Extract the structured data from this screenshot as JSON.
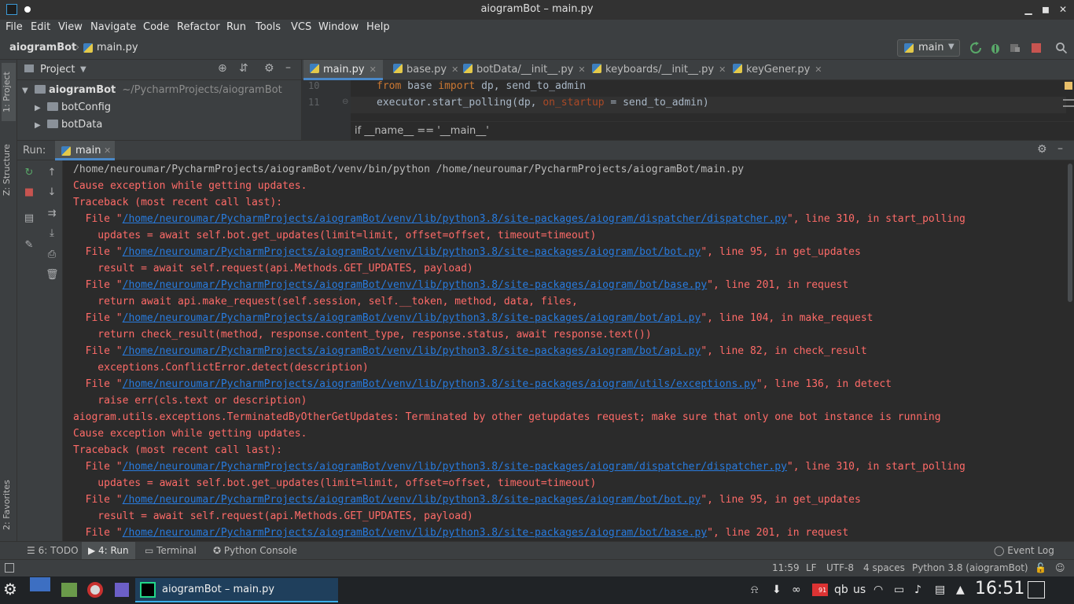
{
  "window": {
    "title": "aiogramBot – main.py"
  },
  "menu": [
    "File",
    "Edit",
    "View",
    "Navigate",
    "Code",
    "Refactor",
    "Run",
    "Tools",
    "VCS",
    "Window",
    "Help"
  ],
  "navbar": {
    "project": "aiogramBot",
    "file": "main.py",
    "run_config": "main"
  },
  "left_strip": {
    "project_tab": "1: Project",
    "structure_tab": "Z: Structure",
    "favorites_tab": "2: Favorites"
  },
  "project_panel": {
    "title": "Project",
    "root": {
      "name": "aiogramBot",
      "path": "~/PycharmProjects/aiogramBot"
    },
    "items": [
      "botConfig",
      "botData"
    ]
  },
  "editor": {
    "tabs": [
      "main.py",
      "base.py",
      "botData/__init__.py",
      "keyboards/__init__.py",
      "keyGener.py"
    ],
    "active_tab": "main.py",
    "lines": [
      {
        "num": "10",
        "kw1": "from",
        "t1": " base ",
        "kw2": "import",
        "t2": " dp, send_to_admin"
      },
      {
        "num": "11",
        "t1": "executor.start_polling(dp, ",
        "param": "on_startup",
        "t2": " = send_to_admin)"
      }
    ],
    "breadcrumb": "if __name__ == '__main__'"
  },
  "run_panel": {
    "label": "Run:",
    "tab": "main",
    "lines": [
      {
        "type": "norm",
        "text": "/home/neuroumar/PycharmProjects/aiogramBot/venv/bin/python /home/neuroumar/PycharmProjects/aiogramBot/main.py"
      },
      {
        "type": "err",
        "text": "Cause exception while getting updates."
      },
      {
        "type": "err",
        "text": "Traceback (most recent call last):"
      },
      {
        "type": "err",
        "pre": "  File \"",
        "link": "/home/neuroumar/PycharmProjects/aiogramBot/venv/lib/python3.8/site-packages/aiogram/dispatcher/dispatcher.py",
        "post": "\", line 310, in start_polling"
      },
      {
        "type": "err",
        "text": "    updates = await self.bot.get_updates(limit=limit, offset=offset, timeout=timeout)"
      },
      {
        "type": "err",
        "pre": "  File \"",
        "link": "/home/neuroumar/PycharmProjects/aiogramBot/venv/lib/python3.8/site-packages/aiogram/bot/bot.py",
        "post": "\", line 95, in get_updates"
      },
      {
        "type": "err",
        "text": "    result = await self.request(api.Methods.GET_UPDATES, payload)"
      },
      {
        "type": "err",
        "pre": "  File \"",
        "link": "/home/neuroumar/PycharmProjects/aiogramBot/venv/lib/python3.8/site-packages/aiogram/bot/base.py",
        "post": "\", line 201, in request"
      },
      {
        "type": "err",
        "text": "    return await api.make_request(self.session, self.__token, method, data, files,"
      },
      {
        "type": "err",
        "pre": "  File \"",
        "link": "/home/neuroumar/PycharmProjects/aiogramBot/venv/lib/python3.8/site-packages/aiogram/bot/api.py",
        "post": "\", line 104, in make_request"
      },
      {
        "type": "err",
        "text": "    return check_result(method, response.content_type, response.status, await response.text())"
      },
      {
        "type": "err",
        "pre": "  File \"",
        "link": "/home/neuroumar/PycharmProjects/aiogramBot/venv/lib/python3.8/site-packages/aiogram/bot/api.py",
        "post": "\", line 82, in check_result"
      },
      {
        "type": "err",
        "text": "    exceptions.ConflictError.detect(description)"
      },
      {
        "type": "err",
        "pre": "  File \"",
        "link": "/home/neuroumar/PycharmProjects/aiogramBot/venv/lib/python3.8/site-packages/aiogram/utils/exceptions.py",
        "post": "\", line 136, in detect"
      },
      {
        "type": "err",
        "text": "    raise err(cls.text or description)"
      },
      {
        "type": "err",
        "text": "aiogram.utils.exceptions.TerminatedByOtherGetUpdates: Terminated by other getupdates request; make sure that only one bot instance is running"
      },
      {
        "type": "err",
        "text": "Cause exception while getting updates."
      },
      {
        "type": "err",
        "text": "Traceback (most recent call last):"
      },
      {
        "type": "err",
        "pre": "  File \"",
        "link": "/home/neuroumar/PycharmProjects/aiogramBot/venv/lib/python3.8/site-packages/aiogram/dispatcher/dispatcher.py",
        "post": "\", line 310, in start_polling"
      },
      {
        "type": "err",
        "text": "    updates = await self.bot.get_updates(limit=limit, offset=offset, timeout=timeout)"
      },
      {
        "type": "err",
        "pre": "  File \"",
        "link": "/home/neuroumar/PycharmProjects/aiogramBot/venv/lib/python3.8/site-packages/aiogram/bot/bot.py",
        "post": "\", line 95, in get_updates"
      },
      {
        "type": "err",
        "text": "    result = await self.request(api.Methods.GET_UPDATES, payload)"
      },
      {
        "type": "err",
        "pre": "  File \"",
        "link": "/home/neuroumar/PycharmProjects/aiogramBot/venv/lib/python3.8/site-packages/aiogram/bot/base.py",
        "post": "\", line 201, in request"
      }
    ]
  },
  "bottom_tabs": {
    "todo": "6: TODO",
    "run": "4: Run",
    "terminal": "Terminal",
    "python_console": "Python Console",
    "event_log": "Event Log"
  },
  "status": {
    "position": "11:59",
    "line_sep": "LF",
    "encoding": "UTF-8",
    "indent": "4 spaces",
    "interpreter": "Python 3.8 (aiogramBot)"
  },
  "taskbar": {
    "active_window": "aiogramBot – main.py",
    "keyboard_layout": "us",
    "clock": "16:51",
    "battery_badge": "91"
  },
  "colors": {
    "accent": "#4a88c7",
    "error_text": "#ff6b68",
    "link": "#287bde",
    "taskbar_highlight": "#3daee9"
  }
}
